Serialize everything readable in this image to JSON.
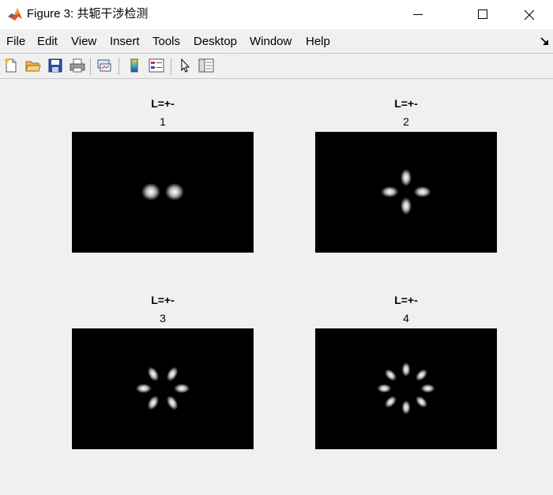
{
  "window": {
    "title": "Figure 3: 共轭干涉检测",
    "icons": {
      "app": "matlab-logo-icon",
      "minimize": "minimize-icon",
      "maximize": "maximize-icon",
      "close": "close-icon"
    }
  },
  "menu": {
    "items": [
      {
        "label": "File"
      },
      {
        "label": "Edit"
      },
      {
        "label": "View"
      },
      {
        "label": "Insert"
      },
      {
        "label": "Tools"
      },
      {
        "label": "Desktop"
      },
      {
        "label": "Window"
      },
      {
        "label": "Help"
      }
    ],
    "collapse_icon": "dock-arrow-icon"
  },
  "toolbar": {
    "buttons": [
      {
        "icon": "new-figure-icon"
      },
      {
        "icon": "open-folder-icon"
      },
      {
        "icon": "save-icon"
      },
      {
        "icon": "print-icon"
      },
      {
        "icon": "link-plot-icon"
      },
      {
        "icon": "insert-colorbar-icon"
      },
      {
        "icon": "insert-legend-icon"
      },
      {
        "icon": "edit-pointer-icon"
      },
      {
        "icon": "property-editor-icon"
      }
    ]
  },
  "figure": {
    "subplots": [
      {
        "title": "L=+-",
        "subtitle": "1",
        "lobes": 2,
        "image": "interference-two-lobes"
      },
      {
        "title": "L=+-",
        "subtitle": "2",
        "lobes": 4,
        "image": "interference-four-lobes"
      },
      {
        "title": "L=+-",
        "subtitle": "3",
        "lobes": 6,
        "image": "interference-six-lobes"
      },
      {
        "title": "L=+-",
        "subtitle": "4",
        "lobes": 8,
        "image": "interference-eight-lobes"
      }
    ]
  },
  "colors": {
    "background": "#f0f0f0",
    "titlebar": "#ffffff",
    "plot_background": "#000000",
    "lobe": "#ffffff"
  }
}
